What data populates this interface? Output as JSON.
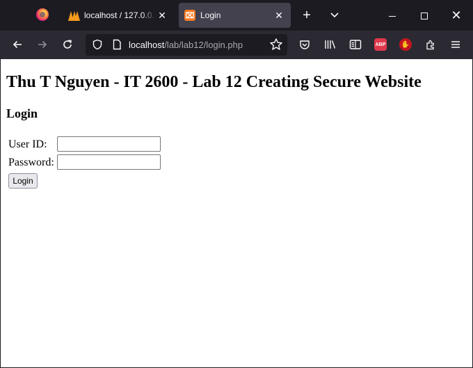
{
  "browser": {
    "tabs": [
      {
        "title": "localhost / 127.0.0.1 / ...",
        "favicon": "phpmyadmin-icon",
        "active": false
      },
      {
        "title": "Login",
        "favicon": "xampp-icon",
        "active": true
      }
    ],
    "url": {
      "host": "localhost",
      "path": "/lab/lab12/login.php"
    },
    "toolbar_icons": [
      "back-arrow-icon",
      "forward-arrow-icon",
      "reload-icon",
      "shield-icon",
      "page-icon",
      "star-icon",
      "pocket-icon",
      "library-icon",
      "reader-view-icon",
      "adblock-plus-icon",
      "ublock-icon",
      "extensions-icon",
      "hamburger-menu-icon"
    ],
    "abp_label": "ABP",
    "xampp_glyph": "⌧"
  },
  "page": {
    "title": "Thu T Nguyen - IT 2600 - Lab 12 Creating Secure Website",
    "section": "Login",
    "form": {
      "user_label": "User ID:",
      "user_value": "",
      "password_label": "Password:",
      "password_value": "",
      "submit_label": "Login"
    }
  },
  "colors": {
    "tabstrip_bg": "#1c1b22",
    "navbar_bg": "#2b2a33",
    "active_tab_bg": "#42414d",
    "page_bg": "#ffffff"
  }
}
